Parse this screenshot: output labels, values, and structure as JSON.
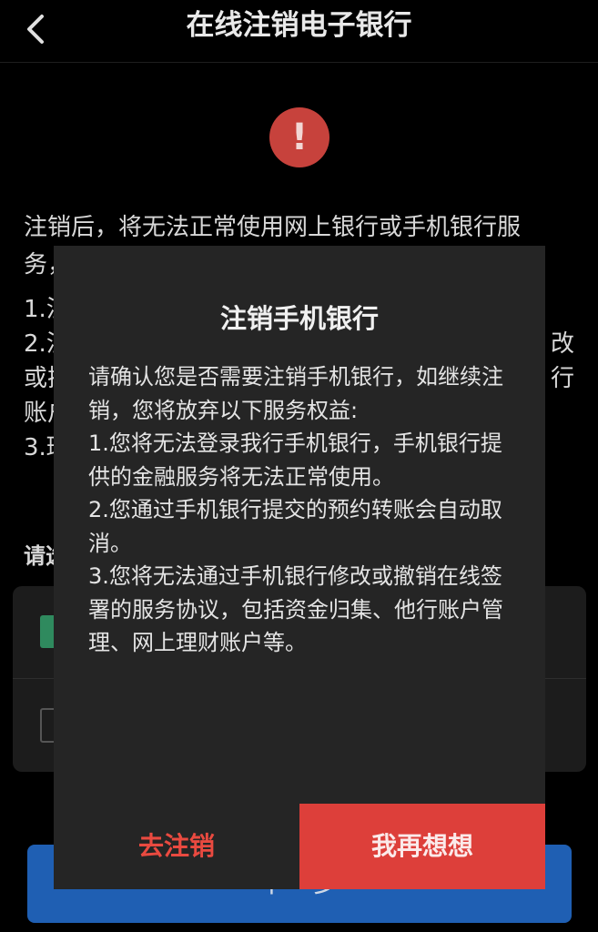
{
  "header": {
    "title": "在线注销电子银行"
  },
  "warning_icon": "exclamation-icon",
  "notice": {
    "intro": "注销后，将无法正常使用网上银行或手机银行服务，",
    "item1": "1.注",
    "item2_left": "2.注",
    "item2_right": "改",
    "item3_left": "或插",
    "item3_right": "行",
    "item4_left": "账户",
    "item5_left": "3.班"
  },
  "select_label": "请选",
  "next_button": {
    "label": "下一步"
  },
  "modal": {
    "title": "注销手机银行",
    "paragraphs": [
      "请确认您是否需要注销手机银行，如继续注销，您将放弃以下服务权益:",
      "1.您将无法登录我行手机银行，手机银行提供的金融服务将无法正常使用。",
      "2.您通过手机银行提交的预约转账会自动取消。",
      "3.您将无法通过手机银行修改或撤销在线签署的服务协议，包括资金归集、他行账户管理、网上理财账户等。"
    ],
    "cancel_label": "去注销",
    "keep_label": "我再想想"
  },
  "colors": {
    "accent_red": "#dd3f3a",
    "button_blue": "#1f5fb3",
    "check_green": "#2f8a5e"
  }
}
